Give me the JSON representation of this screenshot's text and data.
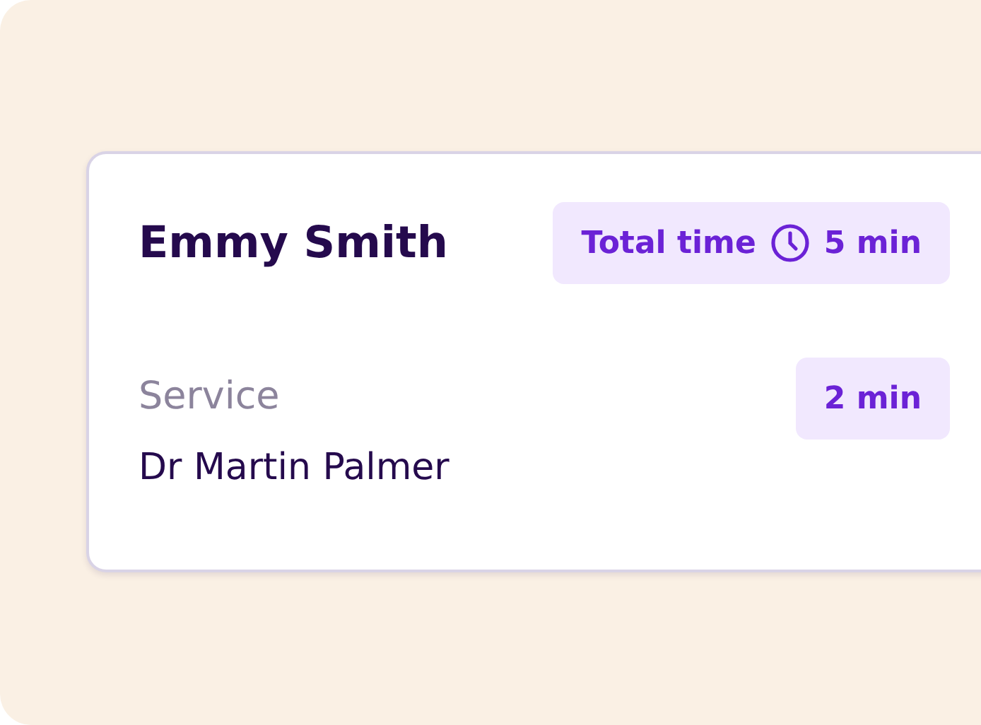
{
  "card": {
    "patient_name": "Emmy Smith",
    "total_time": {
      "label": "Total time",
      "value": "5 min"
    },
    "services": [
      {
        "label": "Service",
        "provider": "Dr Martin Palmer",
        "duration": "2 min"
      }
    ]
  }
}
